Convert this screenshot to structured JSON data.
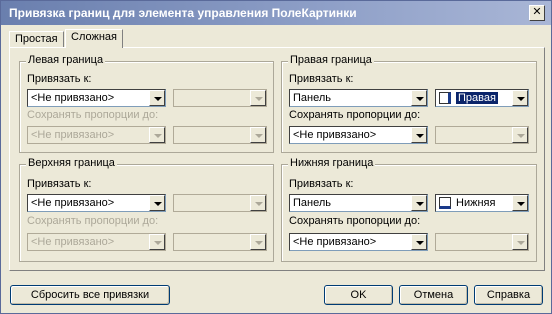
{
  "window": {
    "title": "Привязка границ для элемента управления ПолеКартинки"
  },
  "tabs": [
    {
      "label": "Простая"
    },
    {
      "label": "Сложная"
    }
  ],
  "groups": {
    "left": {
      "caption": "Левая граница",
      "bind_label": "Привязать к:",
      "bind_value": "<Не привязано>",
      "side_value": "",
      "keep_label": "Сохранять пропорции до:",
      "keep_value": "<Не привязано>",
      "keep_side": ""
    },
    "right": {
      "caption": "Правая граница",
      "bind_label": "Привязать к:",
      "bind_value": "Панель",
      "side_value": "Правая",
      "keep_label": "Сохранять пропорции до:",
      "keep_value": "<Не привязано>",
      "keep_side": ""
    },
    "top": {
      "caption": "Верхняя граница",
      "bind_label": "Привязать к:",
      "bind_value": "<Не привязано>",
      "side_value": "",
      "keep_label": "Сохранять пропорции до:",
      "keep_value": "<Не привязано>",
      "keep_side": ""
    },
    "bottom": {
      "caption": "Нижняя граница",
      "bind_label": "Привязать к:",
      "bind_value": "Панель",
      "side_value": "Нижняя",
      "keep_label": "Сохранять пропорции до:",
      "keep_value": "<Не привязано>",
      "keep_side": ""
    }
  },
  "buttons": {
    "reset": "Сбросить все привязки",
    "ok": "OK",
    "cancel": "Отмена",
    "help": "Справка"
  },
  "colors": {
    "title_bar": "#6a7fae",
    "selection": "#0a246a"
  }
}
